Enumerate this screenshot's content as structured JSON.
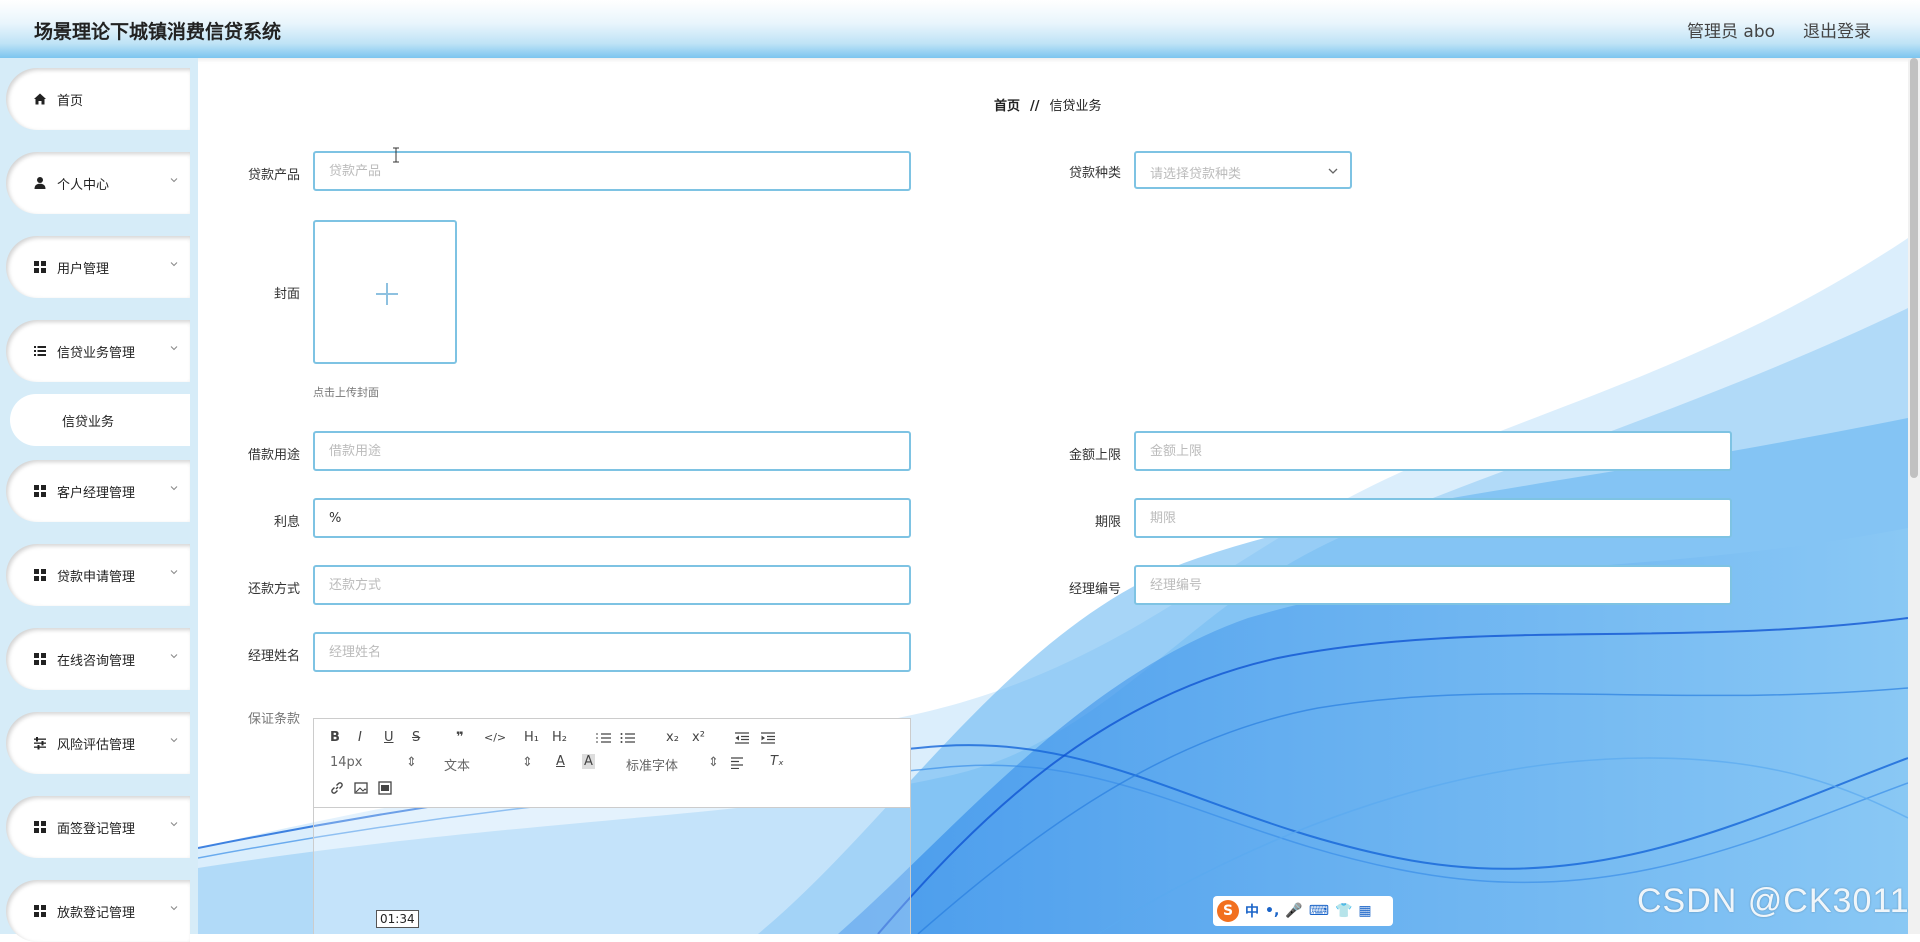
{
  "header": {
    "app_title": "场景理论下城镇消费信贷系统",
    "admin_label": "管理员 abo",
    "logout_label": "退出登录"
  },
  "sidebar": {
    "items": [
      {
        "label": "首页",
        "icon": "home-icon"
      },
      {
        "label": "个人中心",
        "icon": "user-icon"
      },
      {
        "label": "用户管理",
        "icon": "grid-icon"
      },
      {
        "label": "信贷业务管理",
        "icon": "list-icon"
      },
      {
        "label": "客户经理管理",
        "icon": "grid-icon"
      },
      {
        "label": "贷款申请管理",
        "icon": "grid-icon"
      },
      {
        "label": "在线咨询管理",
        "icon": "grid-icon"
      },
      {
        "label": "风险评估管理",
        "icon": "sliders-icon"
      },
      {
        "label": "面签登记管理",
        "icon": "grid-icon"
      },
      {
        "label": "放款登记管理",
        "icon": "grid-icon"
      }
    ],
    "active_sub_item": "信贷业务"
  },
  "breadcrumb": {
    "home": "首页",
    "separator": "//",
    "current": "信贷业务"
  },
  "form": {
    "loan_product": {
      "label": "贷款产品",
      "placeholder": "贷款产品",
      "value": ""
    },
    "loan_type": {
      "label": "贷款种类",
      "placeholder": "请选择贷款种类"
    },
    "cover": {
      "label": "封面",
      "hint": "点击上传封面"
    },
    "loan_purpose": {
      "label": "借款用途",
      "placeholder": "借款用途",
      "value": ""
    },
    "amount_limit": {
      "label": "金额上限",
      "placeholder": "金额上限",
      "value": ""
    },
    "interest": {
      "label": "利息",
      "value": "%"
    },
    "term": {
      "label": "期限",
      "placeholder": "期限",
      "value": ""
    },
    "repayment": {
      "label": "还款方式",
      "placeholder": "还款方式",
      "value": ""
    },
    "manager_id": {
      "label": "经理编号",
      "placeholder": "经理编号",
      "value": ""
    },
    "manager_name": {
      "label": "经理姓名",
      "placeholder": "经理姓名",
      "value": ""
    },
    "guarantee": {
      "label": "保证条款"
    }
  },
  "editor": {
    "font_size": "14px",
    "text_type": "文本",
    "font_family": "标准字体",
    "sub_label": "x₂",
    "sup_label": "x²",
    "h1": "H₁",
    "h2": "H₂",
    "bold": "B",
    "italic": "I",
    "underline": "U",
    "strike": "S",
    "quote": "❞",
    "code": "</>"
  },
  "overlay": {
    "timer": "01:34",
    "ime_label": "中",
    "watermark": "CSDN @CK3011"
  },
  "colors": {
    "accent_border": "#7ec3e3",
    "sidebar_bg": "#d6ecf8",
    "wave_blue": "#1a7be6"
  }
}
